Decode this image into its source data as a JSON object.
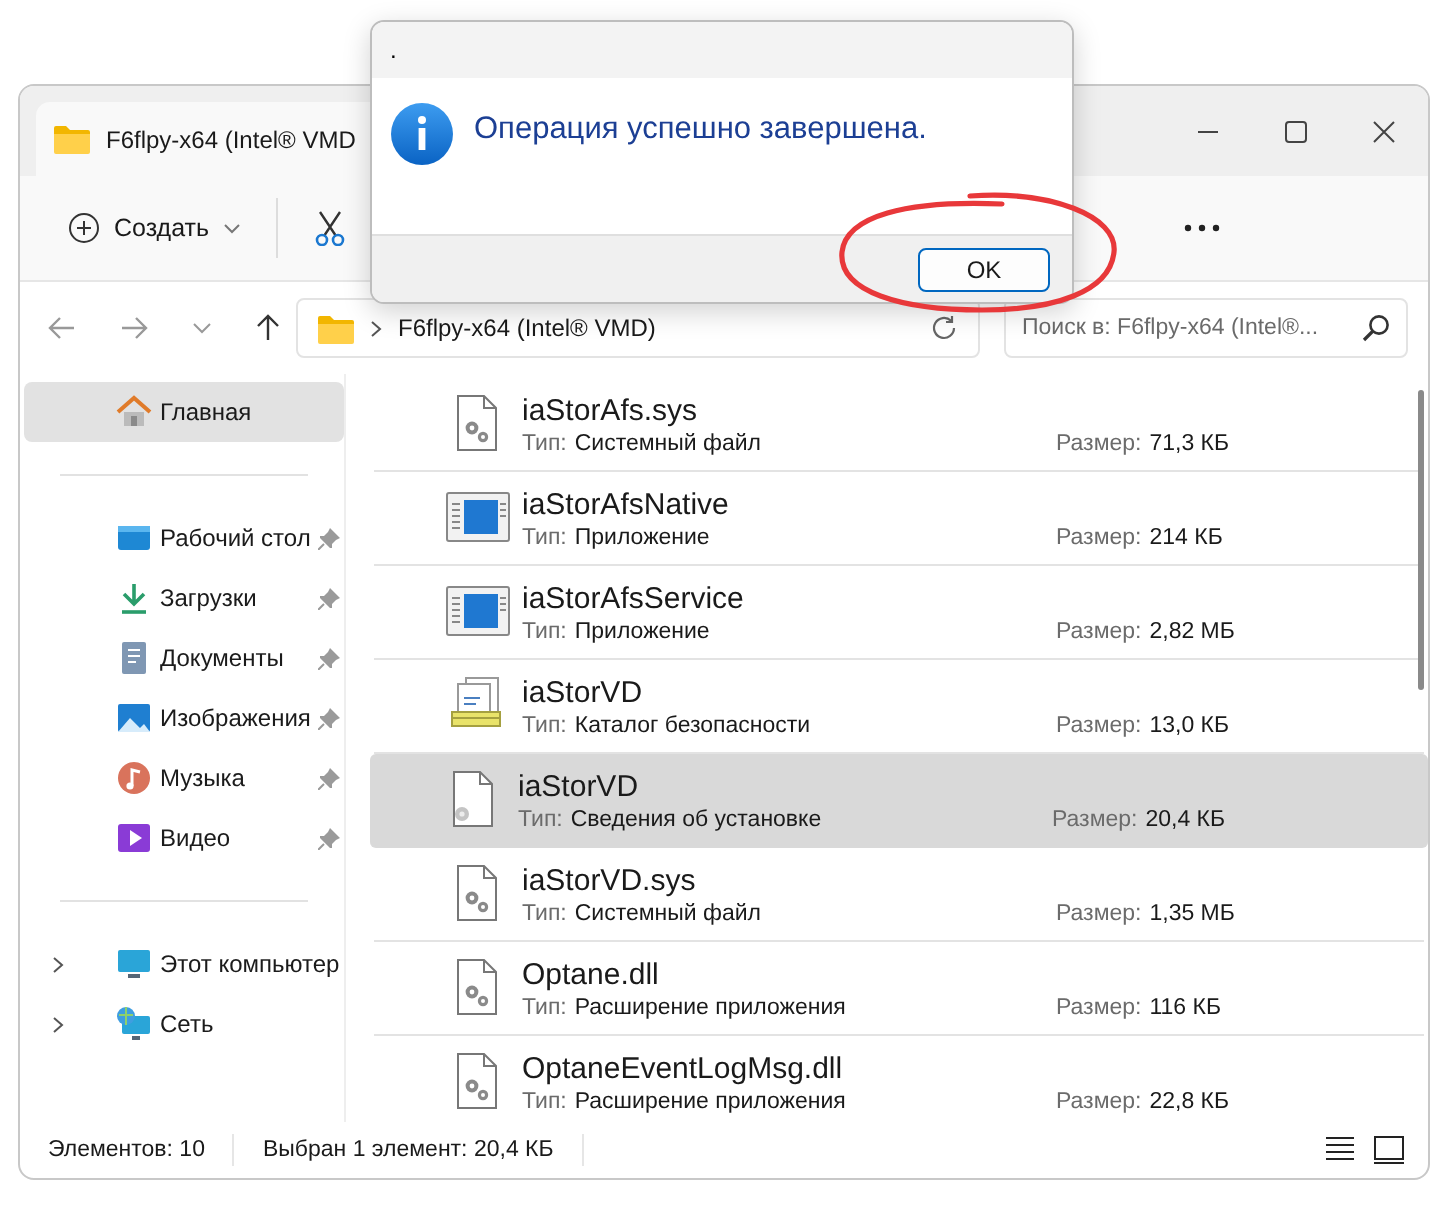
{
  "explorer": {
    "tab_title": "F6flpy-x64 (Intel® VMD",
    "new_label": "Создать",
    "path": "F6flpy-x64 (Intel® VMD)",
    "search_placeholder": "Поиск в: F6flpy-x64 (Intel®..."
  },
  "sidebar": {
    "sections": [
      {
        "items": [
          {
            "label": "Главная",
            "selected": true
          }
        ]
      },
      {
        "items": [
          {
            "label": "Рабочий стол",
            "selected": false,
            "pinned": true
          },
          {
            "label": "Загрузки",
            "selected": false,
            "pinned": true
          },
          {
            "label": "Документы",
            "selected": false,
            "pinned": true
          },
          {
            "label": "Изображения",
            "selected": false,
            "pinned": true
          },
          {
            "label": "Музыка",
            "selected": false,
            "pinned": true
          },
          {
            "label": "Видео",
            "selected": false,
            "pinned": true
          }
        ]
      },
      {
        "items": [
          {
            "label": "Этот компьютер",
            "selected": false,
            "expanded": false
          },
          {
            "label": "Сеть",
            "selected": false,
            "expanded": false
          }
        ]
      }
    ]
  },
  "files": [
    {
      "kind": "sys",
      "name": "iaStorAfs.sys",
      "type_label": "Тип:",
      "type": "Системный файл",
      "size_label": "Размер:",
      "size": "71,3 КБ",
      "selected": false
    },
    {
      "kind": "app",
      "name": "iaStorAfsNative",
      "type_label": "Тип:",
      "type": "Приложение",
      "size_label": "Размер:",
      "size": "214 КБ",
      "selected": false
    },
    {
      "kind": "app",
      "name": "iaStorAfsService",
      "type_label": "Тип:",
      "type": "Приложение",
      "size_label": "Размер:",
      "size": "2,82 МБ",
      "selected": false
    },
    {
      "kind": "catalog",
      "name": "iaStorVD",
      "type_label": "Тип:",
      "type": "Каталог безопасности",
      "size_label": "Размер:",
      "size": "13,0 КБ",
      "selected": false
    },
    {
      "kind": "inf",
      "name": "iaStorVD",
      "type_label": "Тип:",
      "type": "Сведения об установке",
      "size_label": "Размер:",
      "size": "20,4 КБ",
      "selected": true
    },
    {
      "kind": "sys",
      "name": "iaStorVD.sys",
      "type_label": "Тип:",
      "type": "Системный файл",
      "size_label": "Размер:",
      "size": "1,35 МБ",
      "selected": false
    },
    {
      "kind": "sys",
      "name": "Optane.dll",
      "type_label": "Тип:",
      "type": "Расширение приложения",
      "size_label": "Размер:",
      "size": "116 КБ",
      "selected": false
    },
    {
      "kind": "sys",
      "name": "OptaneEventLogMsg.dll",
      "type_label": "Тип:",
      "type": "Расширение приложения",
      "size_label": "Размер:",
      "size": "22,8 КБ",
      "selected": false
    }
  ],
  "status_bar": {
    "count": "Элементов: 10",
    "selection": "Выбран 1 элемент: 20,4 КБ"
  },
  "dialog": {
    "title": ".",
    "message": "Операция успешно завершена.",
    "buttons": [
      "OK"
    ]
  },
  "annotation": {
    "kind": "circle"
  }
}
